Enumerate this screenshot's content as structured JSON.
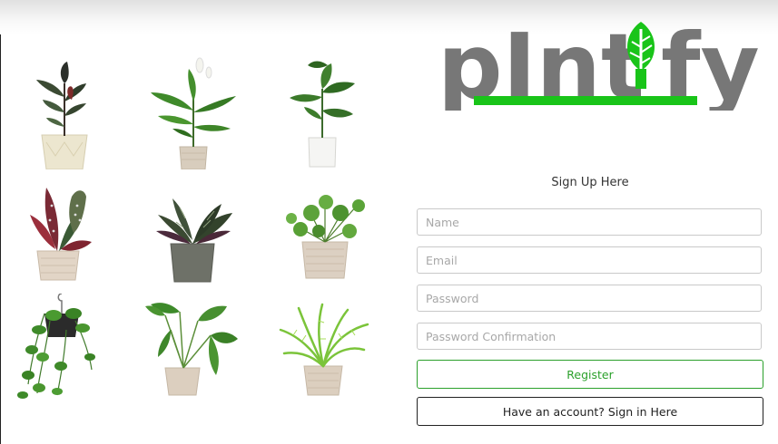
{
  "brand": {
    "logo_text": "plntify",
    "primary_color": "#7a7a7a",
    "accent_color": "#19c419"
  },
  "gallery": {
    "plants": [
      {
        "name": "rubber-plant",
        "pot": "cream-pot"
      },
      {
        "name": "peace-lily",
        "pot": "beige-pot"
      },
      {
        "name": "monstera",
        "pot": "white-pot"
      },
      {
        "name": "begonia",
        "pot": "beige-pot"
      },
      {
        "name": "calathea",
        "pot": "grey-pot"
      },
      {
        "name": "pilea",
        "pot": "beige-pot"
      },
      {
        "name": "pothos-hanging",
        "pot": "black-hanging-pot"
      },
      {
        "name": "alocasia",
        "pot": "beige-pot"
      },
      {
        "name": "fern",
        "pot": "beige-pot"
      }
    ]
  },
  "signup": {
    "title": "Sign Up Here",
    "name_placeholder": "Name",
    "email_placeholder": "Email",
    "password_placeholder": "Password",
    "password_confirmation_placeholder": "Password Confirmation",
    "register_label": "Register",
    "signin_label": "Have an account? Sign in Here"
  }
}
